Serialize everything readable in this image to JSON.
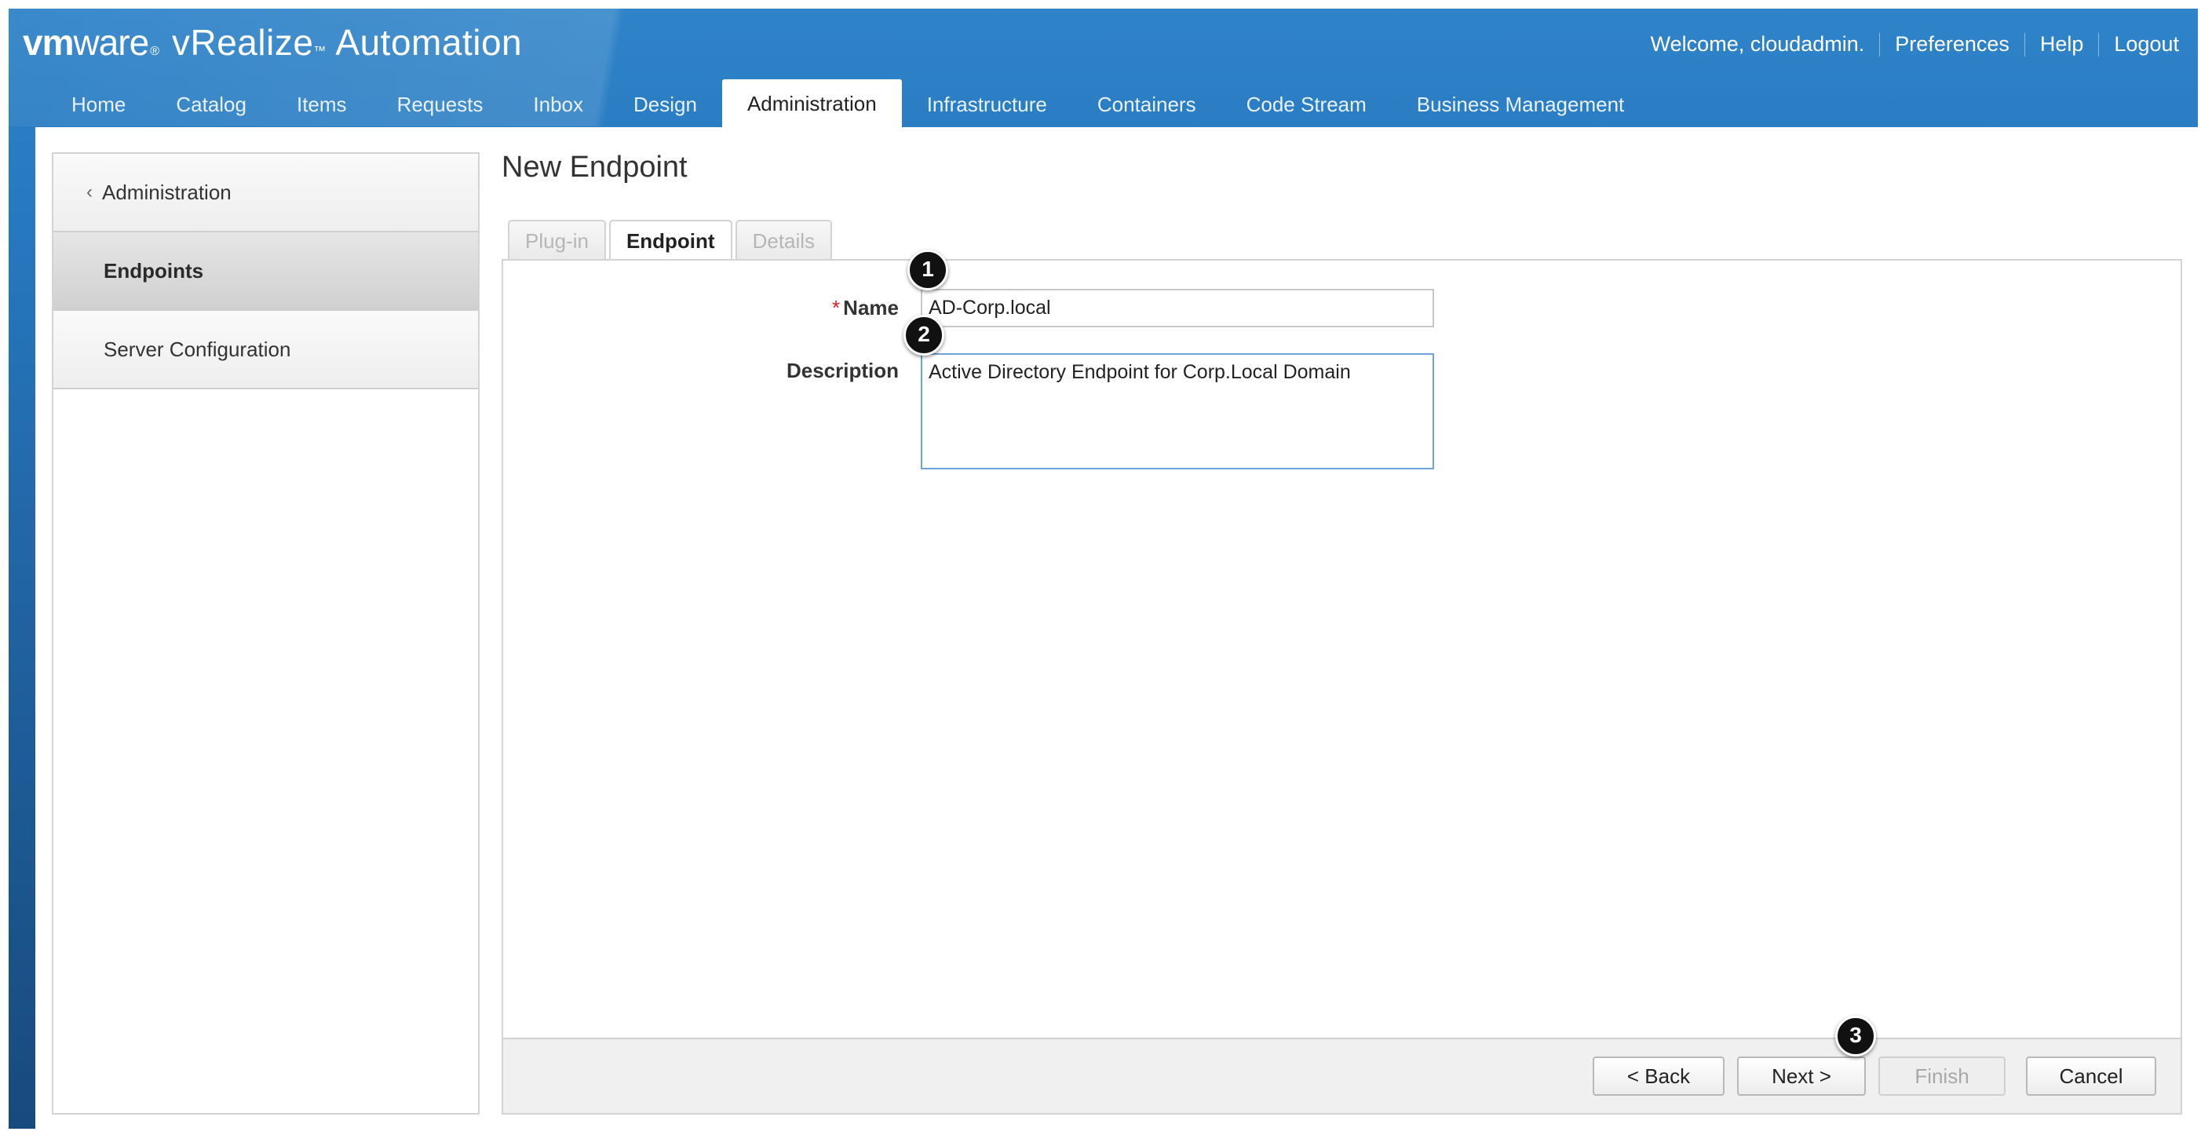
{
  "brand": {
    "vm": "vm",
    "ware": "ware",
    "registered": "®",
    "product": "vRealize",
    "trademark": "™",
    "suffix": "Automation"
  },
  "header": {
    "welcome": "Welcome, cloudadmin.",
    "links": [
      "Preferences",
      "Help",
      "Logout"
    ]
  },
  "nav": {
    "tabs": [
      "Home",
      "Catalog",
      "Items",
      "Requests",
      "Inbox",
      "Design",
      "Administration",
      "Infrastructure",
      "Containers",
      "Code Stream",
      "Business Management"
    ],
    "active": "Administration"
  },
  "sidebar": {
    "back_label": "Administration",
    "items": [
      "Endpoints",
      "Server Configuration"
    ],
    "selected": "Endpoints"
  },
  "page": {
    "title": "New Endpoint"
  },
  "wizard": {
    "tabs": [
      "Plug-in",
      "Endpoint",
      "Details"
    ],
    "active": "Endpoint"
  },
  "form": {
    "required_marker": "*",
    "name_label": "Name",
    "name_value": "AD-Corp.local",
    "description_label": "Description",
    "description_value": "Active Directory Endpoint for Corp.Local Domain"
  },
  "callouts": [
    "1",
    "2",
    "3"
  ],
  "buttons": {
    "back": "< Back",
    "next": "Next >",
    "finish": "Finish",
    "cancel": "Cancel"
  },
  "colors": {
    "header_blue": "#2a7cc4",
    "required_red": "#d02020"
  }
}
